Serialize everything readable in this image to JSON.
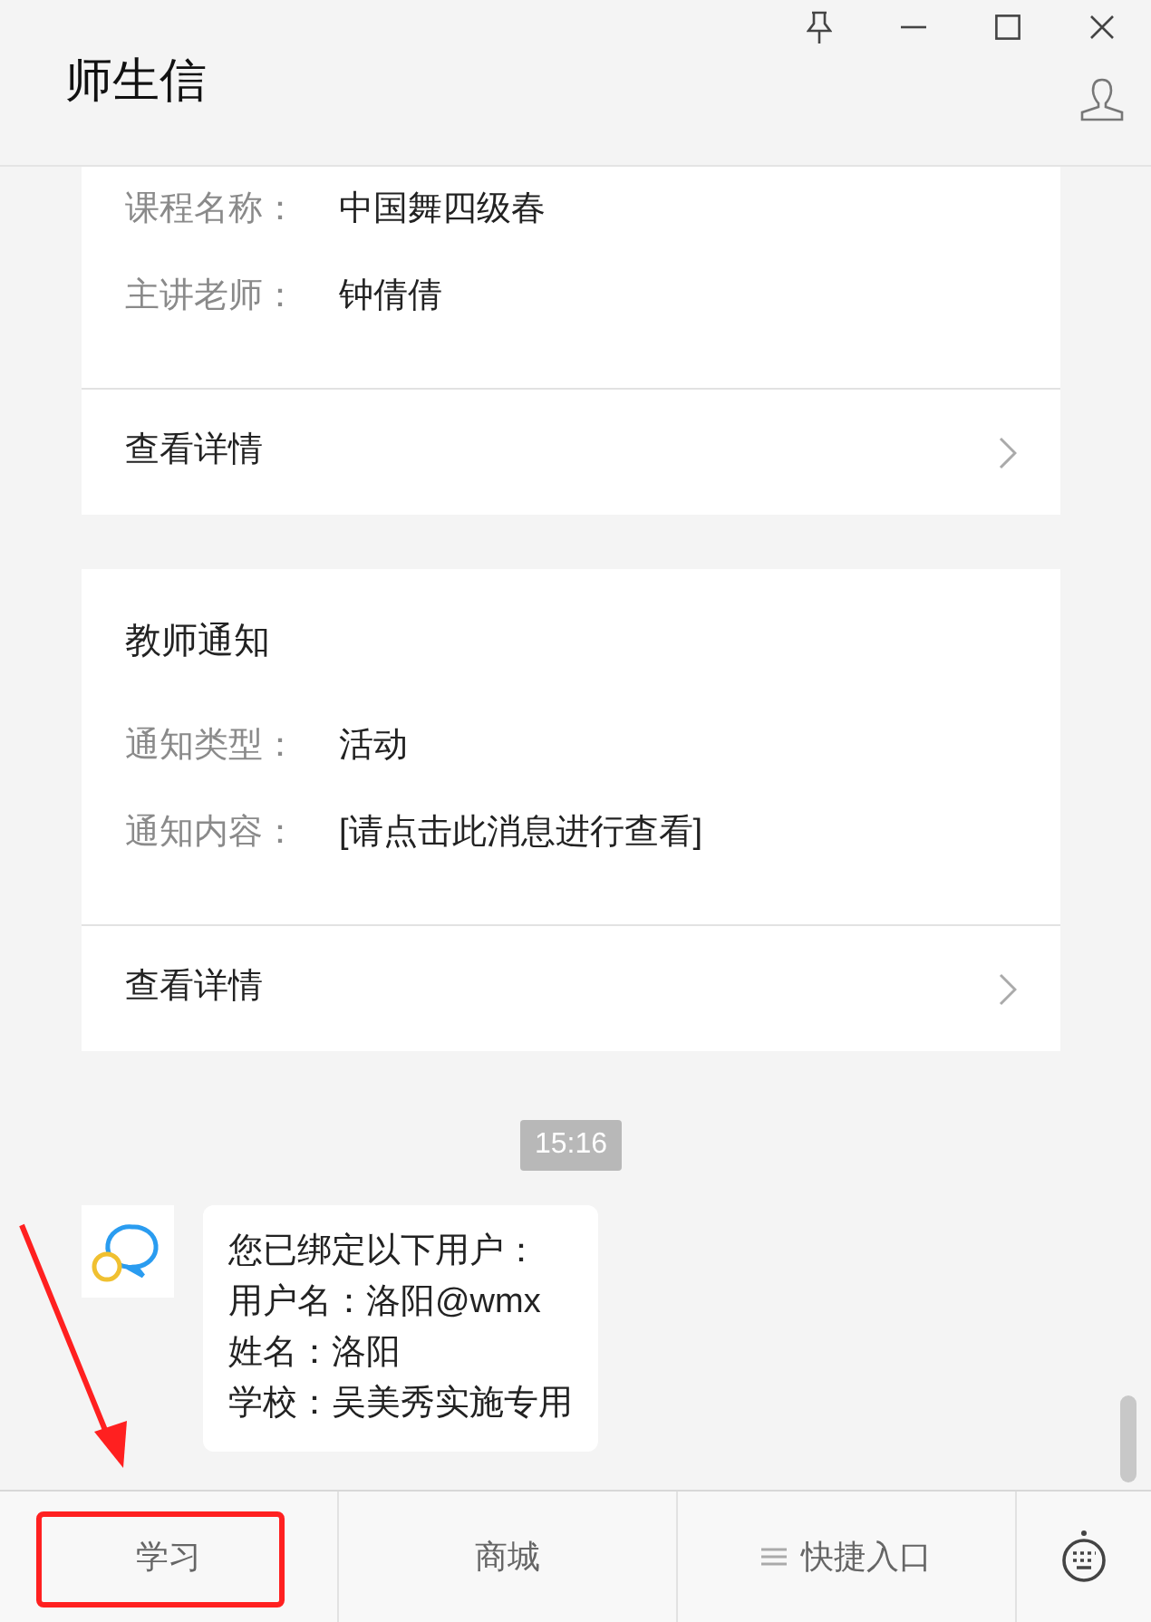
{
  "window": {
    "title": "师生信"
  },
  "cards": [
    {
      "fields": [
        {
          "label": "课程名称：",
          "value": "中国舞四级春"
        },
        {
          "label": "主讲老师：",
          "value": "钟倩倩"
        }
      ],
      "link": "查看详情"
    },
    {
      "title": "教师通知",
      "fields": [
        {
          "label": "通知类型：",
          "value": "活动"
        },
        {
          "label": "通知内容：",
          "value": "[请点击此消息进行查看]"
        }
      ],
      "link": "查看详情"
    }
  ],
  "chat": {
    "time": "15:16",
    "message": [
      "您已绑定以下用户：",
      "用户名：洛阳@wmx",
      "姓名：洛阳",
      "学校：吴美秀实施专用"
    ]
  },
  "bottom_menu": [
    {
      "label": "学习",
      "kind": "plain",
      "annotated": true
    },
    {
      "label": "商城",
      "kind": "plain",
      "annotated": false
    },
    {
      "label": "快捷入口",
      "kind": "menu",
      "annotated": false
    }
  ]
}
